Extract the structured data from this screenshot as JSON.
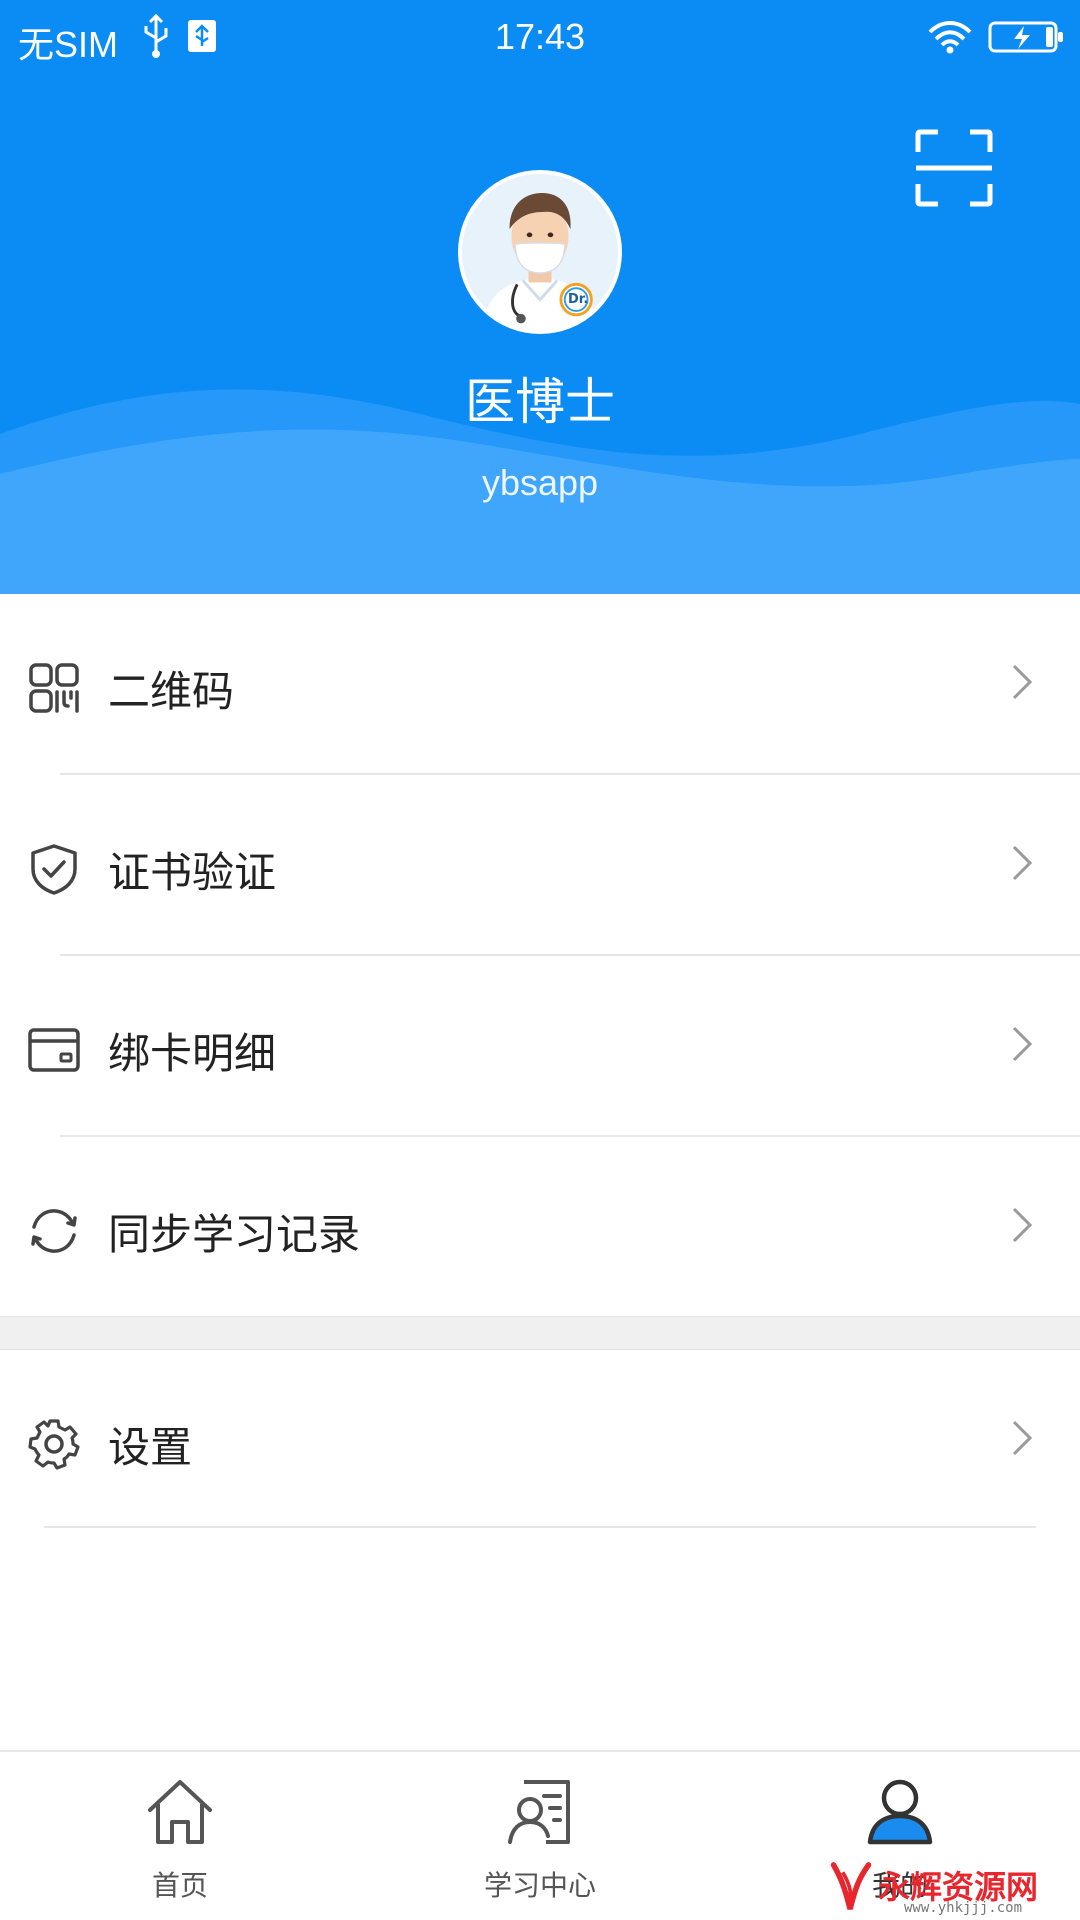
{
  "status_bar": {
    "carrier": "无SIM",
    "time": "17:43"
  },
  "profile": {
    "name": "医博士",
    "user_id": "ybsapp",
    "avatar_badge": "Dr."
  },
  "menu": {
    "items": [
      {
        "label": "二维码",
        "icon": "qr-code-icon"
      },
      {
        "label": "证书验证",
        "icon": "shield-check-icon"
      },
      {
        "label": "绑卡明细",
        "icon": "card-icon"
      },
      {
        "label": "同步学习记录",
        "icon": "sync-icon"
      },
      {
        "label": "设置",
        "icon": "gear-icon"
      }
    ]
  },
  "tab_bar": {
    "tabs": [
      {
        "label": "首页",
        "icon": "home-icon"
      },
      {
        "label": "学习中心",
        "icon": "study-center-icon"
      },
      {
        "label": "我的",
        "icon": "profile-icon"
      }
    ],
    "active_index": 2
  },
  "watermark": {
    "text": "永辉资源网",
    "url": "www.yhkjjj.com"
  },
  "colors": {
    "header_blue": "#0b8cf5",
    "wave_blue": "#3aa3fb",
    "active_tab_blue": "#1a8cf0"
  }
}
